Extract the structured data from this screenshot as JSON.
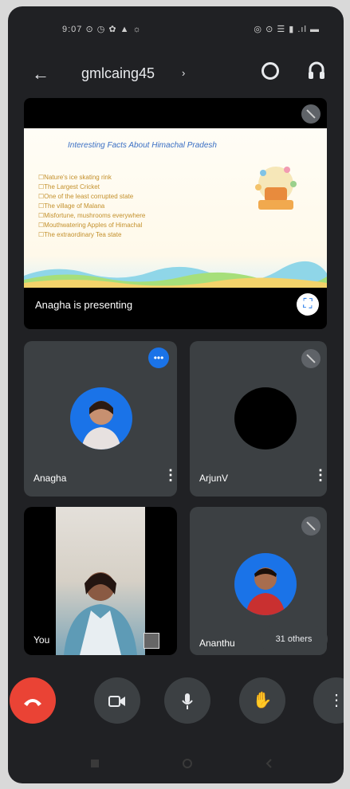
{
  "status": {
    "left": "9:07 ⊙ ◷ ✿ ▲ ☼",
    "right": "◎ ⊙ ☰ ▮ .ıl ▬"
  },
  "meeting": {
    "title": "gmlcaing45",
    "chevron": "›"
  },
  "presentation": {
    "slide_title": "Interesting Facts About Himachal Pradesh",
    "slide_items": [
      "Nature's ice skating rink",
      "The Largest Cricket",
      "One of the least corrupted state",
      "The village of Malana",
      "Misfortune, mushrooms everywhere",
      "Mouthwatering Apples of Himachal",
      "The extraordinary Tea state"
    ],
    "label": "Anagha is presenting"
  },
  "participants": [
    {
      "name": "Anagha"
    },
    {
      "name": "ArjunV"
    },
    {
      "name": "You"
    },
    {
      "name": "Ananthu"
    }
  ],
  "others_chip": "31 others",
  "colors": {
    "background": "#202124",
    "tile": "#3c4043",
    "hangup": "#ea4335",
    "accent": "#1a73e8"
  }
}
